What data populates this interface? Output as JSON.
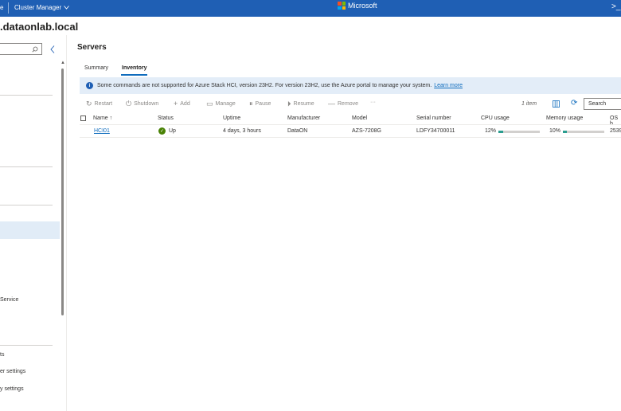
{
  "topbar": {
    "left_crumb": "e",
    "cluster_manager": "Cluster Manager",
    "chevron": "chevron-down-icon",
    "brand": "Microsoft",
    "terminal": ">_"
  },
  "host_title": ".dataonlab.local",
  "left_nav": {
    "search_icon": "search-icon",
    "collapse_icon": "chevron-left-icon",
    "items": [
      {
        "label": "Service"
      },
      {
        "label": "ts"
      },
      {
        "label": "er settings"
      },
      {
        "label": "y settings"
      }
    ]
  },
  "page_title": "Servers",
  "tabs": [
    {
      "label": "Summary"
    },
    {
      "label": "Inventory"
    }
  ],
  "banner": {
    "text": "Some commands are not supported for Azure Stack HCI, version 23H2. For version 23H2, use the Azure portal to manage your system.",
    "link": "Learn more"
  },
  "toolbar": {
    "restart": "Restart",
    "shutdown": "Shutdown",
    "add": "Add",
    "manage": "Manage",
    "pause": "Pause",
    "resume": "Resume",
    "remove": "Remove",
    "more": "···",
    "count": "1 item",
    "search_placeholder": "Search"
  },
  "table": {
    "columns": [
      "Name ↑",
      "Status",
      "Uptime",
      "Manufacturer",
      "Model",
      "Serial number",
      "CPU usage",
      "Memory usage",
      "OS b"
    ],
    "rows": [
      {
        "name": "HCI01",
        "status": "Up",
        "uptime": "4 days, 3 hours",
        "manufacturer": "DataON",
        "model": "AZS-7208G",
        "serial": "LDFY34700011",
        "cpu": "12%",
        "cpu_value": 12,
        "memory": "10%",
        "memory_value": 10,
        "os": "2539"
      }
    ]
  },
  "colors": {
    "topbar": "#1f5fb4",
    "accent": "#0f6cbd",
    "status_ok": "#498205",
    "usage_bar": "#2a9d8f",
    "banner_bg": "#e3edf8"
  }
}
